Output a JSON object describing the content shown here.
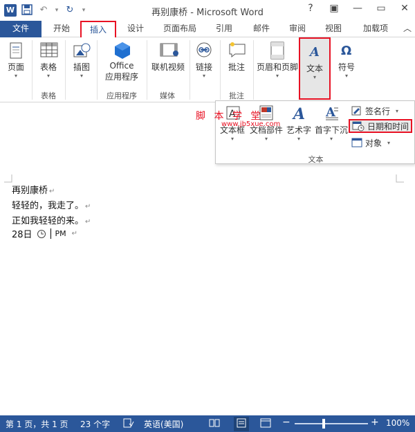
{
  "window": {
    "title": "再别康桥 - Microsoft Word",
    "app_icon_letter": "W",
    "help": "?",
    "restore": "▣",
    "minimize": "—",
    "close": "✕"
  },
  "qat": {
    "save": "💾",
    "undo": "↶",
    "undo_drop": "▾",
    "redo": "↻",
    "customize": "▾"
  },
  "tabs": [
    "文件",
    "开始",
    "插入",
    "设计",
    "页面布局",
    "引用",
    "邮件",
    "审阅",
    "视图",
    "加载项"
  ],
  "active_tab": "插入",
  "ribbon": {
    "pages": "页面",
    "table": "表格",
    "illustrations": "插图",
    "office_apps_1": "Office",
    "office_apps_2": "应用程序",
    "online_video": "联机视频",
    "link": "链接",
    "comment": "批注",
    "header_footer": "页眉和页脚",
    "text": "文本",
    "symbols": "符号",
    "arrow": "▾",
    "groups": {
      "table": "表格",
      "apps": "应用程序",
      "media": "媒体",
      "comments": "批注"
    }
  },
  "text_dropdown": {
    "textbox": "文本框",
    "quick_parts": "文档部件",
    "wordart": "艺术字",
    "dropcap": "首字下沉",
    "signature_line": "签名行",
    "date_time": "日期和时间",
    "object": "对象",
    "group_label": "文本"
  },
  "watermark": {
    "text": "脚 本 学 堂",
    "url": "www.jb5xue.com"
  },
  "document": {
    "lines": [
      "再别康桥",
      "轻轻的，我走了。",
      "正如我轻轻的来。"
    ],
    "date_line_1": "28日",
    "date_line_2": "PM",
    "pilcrow": "↵"
  },
  "status_bar": {
    "page": "第 1 页，共 1 页",
    "words": "23 个字",
    "language": "英语(美国)",
    "zoom_minus": "−",
    "zoom_plus": "+",
    "zoom": "100%"
  },
  "colors": {
    "accent": "#2b579a",
    "highlight": "#e81123"
  }
}
